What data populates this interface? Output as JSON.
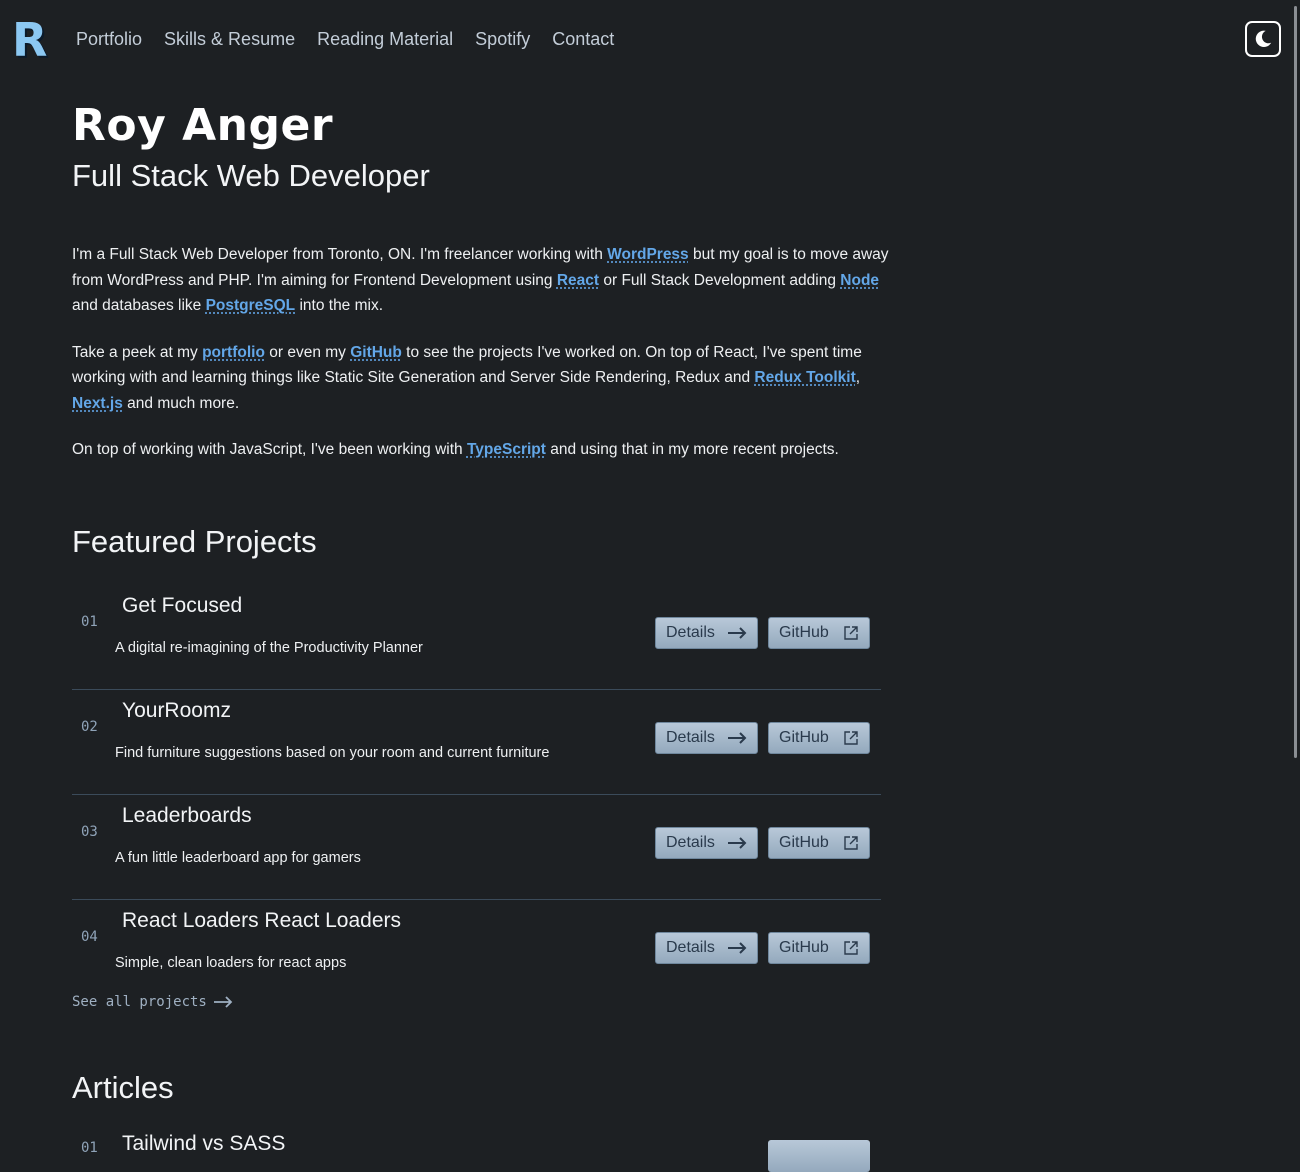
{
  "nav": {
    "logo_letter": "R",
    "links": [
      "Portfolio",
      "Skills & Resume",
      "Reading Material",
      "Spotify",
      "Contact"
    ],
    "theme_toggle_icon": "moon-icon"
  },
  "hero": {
    "name": "Roy Anger",
    "title": "Full Stack Web Developer"
  },
  "about": {
    "p1": {
      "t1": "I'm a Full Stack Web Developer from Toronto, ON. I'm freelancer working with ",
      "l1": "WordPress",
      "t2": " but my goal is to move away from WordPress and PHP. I'm aiming for Frontend Development using ",
      "l2": "React",
      "t3": " or Full Stack Development adding ",
      "l3": "Node",
      "t4": " and databases like ",
      "l4": "PostgreSQL",
      "t5": " into the mix."
    },
    "p2": {
      "t1": "Take a peek at my ",
      "l1": "portfolio",
      "t2": " or even my ",
      "l2": "GitHub",
      "t3": " to see the projects I've worked on. On top of React, I've spent time working with and learning things like Static Site Generation and Server Side Rendering, Redux and ",
      "l3": "Redux Toolkit",
      "t4": ", ",
      "l4": "Next.js",
      "t5": " and much more."
    },
    "p3": {
      "t1": "On top of working with JavaScript, I've been working with ",
      "l1": "TypeScript",
      "t2": " and using that in my more recent projects."
    }
  },
  "featured": {
    "heading": "Featured Projects",
    "details_label": "Details",
    "github_label": "GitHub",
    "projects": [
      {
        "num": "01",
        "title": "Get Focused",
        "desc": "A digital re-imagining of the Productivity Planner"
      },
      {
        "num": "02",
        "title": "YourRoomz",
        "desc": "Find furniture suggestions based on your room and current furniture"
      },
      {
        "num": "03",
        "title": "Leaderboards",
        "desc": "A fun little leaderboard app for gamers"
      },
      {
        "num": "04",
        "title": "React Loaders React Loaders",
        "desc": "Simple, clean loaders for react apps"
      }
    ],
    "see_all": "See all projects"
  },
  "articles": {
    "heading": "Articles",
    "items": [
      {
        "num": "01",
        "title": "Tailwind vs SASS"
      }
    ]
  },
  "colors": {
    "background": "#1d2023",
    "link": "#63a7e8",
    "logo": "#8cc8f2",
    "nav_text": "#c3cdd8",
    "button_bg": "#a7bacd"
  }
}
